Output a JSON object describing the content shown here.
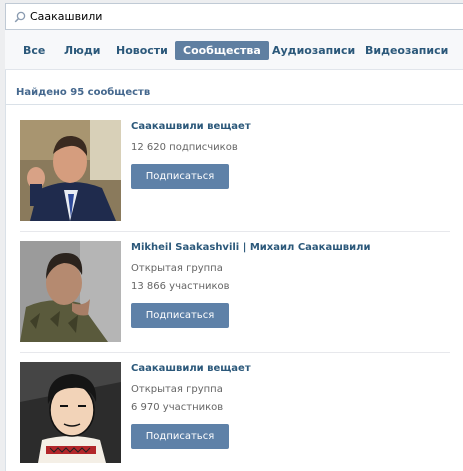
{
  "search": {
    "value": "Саакашвили"
  },
  "tabs": [
    {
      "label": "Все"
    },
    {
      "label": "Люди"
    },
    {
      "label": "Новости"
    },
    {
      "label": "Сообщества"
    },
    {
      "label": "Аудиозаписи"
    },
    {
      "label": "Видеозаписи"
    }
  ],
  "results": {
    "count_text": "Найдено 95 сообществ"
  },
  "groups": [
    {
      "name": "Саакашвили вещает",
      "type": "",
      "members": "12 620 подписчиков",
      "button": "Подписаться"
    },
    {
      "name": "Mikheil Saakashvili | Михаил Саакашвили",
      "type": "Открытая группа",
      "members": "13 866 участников",
      "button": "Подписаться"
    },
    {
      "name": "Саакашвили вещает",
      "type": "Открытая группа",
      "members": "6 970 участников",
      "button": "Подписаться"
    }
  ],
  "colors": {
    "accent": "#5e81a8",
    "link": "#2b587a",
    "background": "#edeef0"
  }
}
